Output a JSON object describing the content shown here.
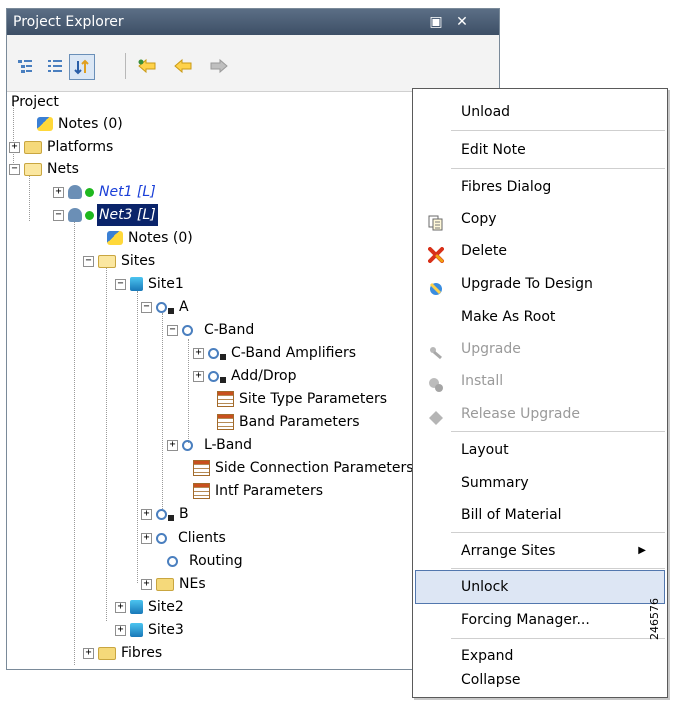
{
  "window": {
    "title": "Project Explorer",
    "restore_glyph": "▣",
    "close_glyph": "✕"
  },
  "toolbar": {
    "buttons": [
      "tree-view-icon",
      "list-view-icon",
      "sort-icon",
      "back-star-icon",
      "back-icon",
      "forward-icon"
    ]
  },
  "tree": {
    "root": "Project",
    "nodes": [
      {
        "label": "Notes (0)"
      },
      {
        "label": "Platforms"
      },
      {
        "label": "Nets"
      },
      {
        "label": "Net1 [L]"
      },
      {
        "label": "Net3 [L]"
      },
      {
        "label": "Notes (0)"
      },
      {
        "label": "Sites"
      },
      {
        "label": "Site1"
      },
      {
        "label": "A"
      },
      {
        "label": "C-Band"
      },
      {
        "label": "C-Band Amplifiers"
      },
      {
        "label": "Add/Drop"
      },
      {
        "label": "Site Type Parameters"
      },
      {
        "label": "Band Parameters"
      },
      {
        "label": "L-Band"
      },
      {
        "label": "Side Connection Parameters"
      },
      {
        "label": "Intf Parameters"
      },
      {
        "label": "B"
      },
      {
        "label": "Clients"
      },
      {
        "label": "Routing"
      },
      {
        "label": "NEs"
      },
      {
        "label": "Site2"
      },
      {
        "label": "Site3"
      },
      {
        "label": "Fibres"
      }
    ],
    "expand_glyph": "+",
    "collapse_glyph": "−"
  },
  "menu": {
    "items": [
      {
        "label": "Unload"
      },
      {
        "label": "Edit Note"
      },
      {
        "label": "Fibres Dialog"
      },
      {
        "label": "Copy",
        "icon": "copy-icon"
      },
      {
        "label": "Delete",
        "icon": "delete-icon"
      },
      {
        "label": "Upgrade To Design",
        "icon": "upgrade-design-icon"
      },
      {
        "label": "Make As Root"
      },
      {
        "label": "Upgrade",
        "icon": "upgrade-icon",
        "disabled": true
      },
      {
        "label": "Install",
        "icon": "install-icon",
        "disabled": true
      },
      {
        "label": "Release Upgrade",
        "icon": "release-upgrade-icon",
        "disabled": true
      },
      {
        "label": "Layout"
      },
      {
        "label": "Summary"
      },
      {
        "label": "Bill of Material"
      },
      {
        "label": "Arrange Sites",
        "submenu": true
      },
      {
        "label": "Unlock",
        "highlighted": true
      },
      {
        "label": "Forcing Manager..."
      },
      {
        "label": "Expand"
      },
      {
        "label": "Collapse"
      }
    ],
    "submenu_arrow": "▶"
  },
  "figure_id": "246576"
}
